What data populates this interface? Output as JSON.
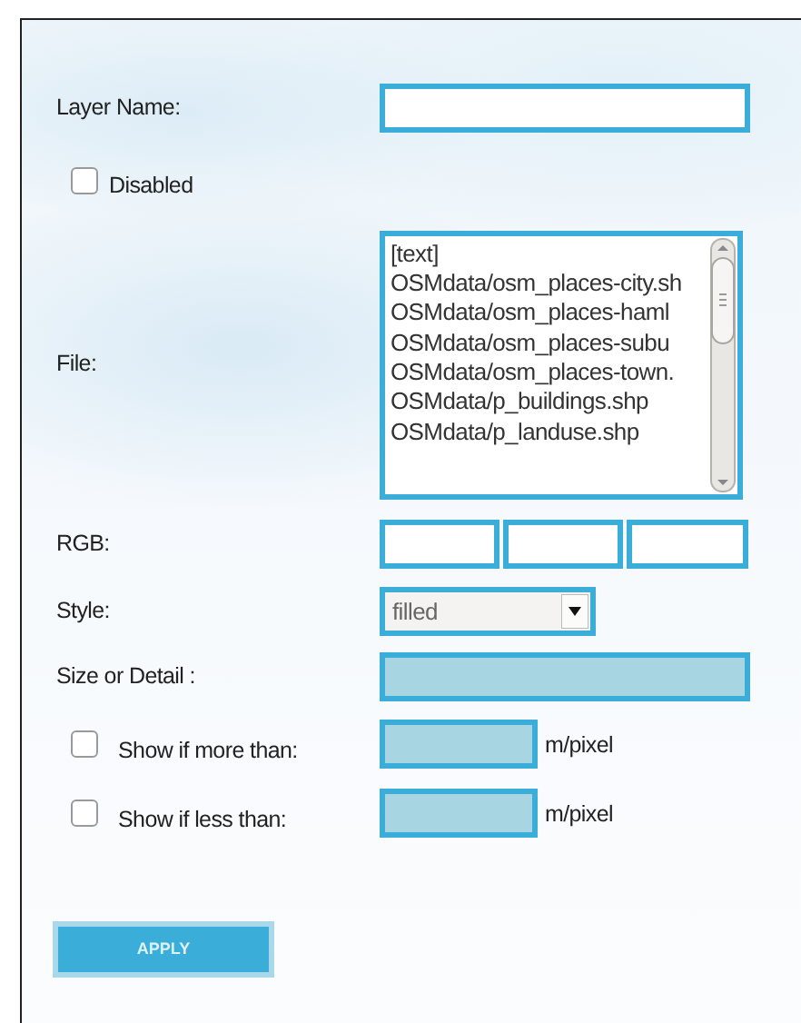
{
  "layer_name": {
    "label": "Layer Name:"
  },
  "disabled": {
    "label": "Disabled",
    "checked": false
  },
  "file": {
    "label": "File:",
    "options": [
      {
        "text": "[text]",
        "selected": false
      },
      {
        "text": "OSMdata/osm_places-city.sh",
        "selected": false
      },
      {
        "text": "OSMdata/osm_places-haml",
        "selected": false
      },
      {
        "text": "OSMdata/osm_places-subu",
        "selected": false
      },
      {
        "text": "OSMdata/osm_places-town.",
        "selected": false
      },
      {
        "text": "OSMdata/p_buildings.shp",
        "selected": false
      },
      {
        "text": "OSMdata/p_landuse.shp",
        "selected": false
      }
    ]
  },
  "rgb": {
    "label": "RGB:"
  },
  "style": {
    "label": "Style:",
    "value": "filled"
  },
  "size_or_detail": {
    "label": "Size or Detail :"
  },
  "show_if_more": {
    "label": "Show if more than:",
    "checked": false,
    "unit": "m/pixel"
  },
  "show_if_less": {
    "label": "Show if less than:",
    "checked": false,
    "unit": "m/pixel"
  },
  "apply_button": "APPLY"
}
